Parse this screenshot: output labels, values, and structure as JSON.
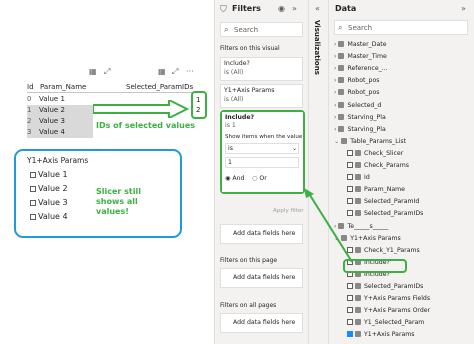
{
  "table": {
    "headers": [
      "Id",
      "Param_Name",
      "Selected_ParamIDs"
    ],
    "rows": [
      {
        "id": "0",
        "name": "Value 1"
      },
      {
        "id": "1",
        "name": "Value 2"
      },
      {
        "id": "2",
        "name": "Value 3"
      },
      {
        "id": "3",
        "name": "Value 4"
      }
    ],
    "selected_ids": [
      "1",
      "2"
    ]
  },
  "annot": {
    "ids_label": "IDs of selected values",
    "slicer_note": "Slicer still shows all values!"
  },
  "slicer": {
    "title": "Y1+Axis Params",
    "items": [
      "Value 1",
      "Value 2",
      "Value 3",
      "Value 4"
    ]
  },
  "filters": {
    "title": "Filters",
    "search": "Search",
    "on_visual": "Filters on this visual",
    "card1": {
      "name": "Include?",
      "value": "is (All)"
    },
    "card2": {
      "name": "Y1+Axis Params",
      "value": "is (All)"
    },
    "card3": {
      "name": "Include?",
      "value": "is 1",
      "show": "Show items when the value",
      "op": "is",
      "val": "1",
      "and": "And",
      "or": "Or",
      "apply": "Apply filter"
    },
    "add": "Add data fields here",
    "on_page": "Filters on this page",
    "on_all": "Filters on all pages"
  },
  "vis": {
    "label": "Visualizations"
  },
  "data": {
    "title": "Data",
    "search": "Search",
    "items": [
      {
        "t": "Master_Date",
        "lvl": 0,
        "k": "tbl"
      },
      {
        "t": "Master_Time",
        "lvl": 0,
        "k": "tbl"
      },
      {
        "t": "Reference_...",
        "lvl": 0,
        "k": "tbl"
      },
      {
        "t": "Robot_pos",
        "lvl": 0,
        "k": "tbl"
      },
      {
        "t": "Robot_pos",
        "lvl": 0,
        "k": "tbl"
      },
      {
        "t": "Selected_d",
        "lvl": 0,
        "k": "tbl"
      },
      {
        "t": "Starving_Pla",
        "lvl": 0,
        "k": "tbl"
      },
      {
        "t": "Starving_Pla",
        "lvl": 0,
        "k": "tbl"
      },
      {
        "t": "Table_Params_List",
        "lvl": 0,
        "k": "open"
      },
      {
        "t": "Check_Slicer",
        "lvl": 1,
        "k": "f"
      },
      {
        "t": "Check_Params",
        "lvl": 1,
        "k": "f"
      },
      {
        "t": "Id",
        "lvl": 1,
        "k": "f"
      },
      {
        "t": "Param_Name",
        "lvl": 1,
        "k": "f"
      },
      {
        "t": "Selected_ParamId",
        "lvl": 1,
        "k": "f"
      },
      {
        "t": "Selected_ParamIDs",
        "lvl": 1,
        "k": "f"
      },
      {
        "t": "Te_____s_____",
        "lvl": 0,
        "k": "tbl"
      },
      {
        "t": "Y1+Axis Params",
        "lvl": 0,
        "k": "open"
      },
      {
        "t": "Check_Y1_Params",
        "lvl": 1,
        "k": "f"
      },
      {
        "t": "Include?",
        "lvl": 1,
        "k": "f"
      },
      {
        "t": "Include?",
        "lvl": 1,
        "k": "f"
      },
      {
        "t": "Selected_ParamIDs",
        "lvl": 1,
        "k": "f"
      },
      {
        "t": "Y+Axis Params Fields",
        "lvl": 1,
        "k": "f"
      },
      {
        "t": "Y+Axis Params Order",
        "lvl": 1,
        "k": "f"
      },
      {
        "t": "Y1_Selected_Param",
        "lvl": 1,
        "k": "f"
      },
      {
        "t": "Y1+Axis Params",
        "lvl": 1,
        "k": "c"
      }
    ]
  },
  "colors": {
    "green": "#3cb043",
    "blue": "#1f9bd7",
    "accent": "#118dff"
  }
}
